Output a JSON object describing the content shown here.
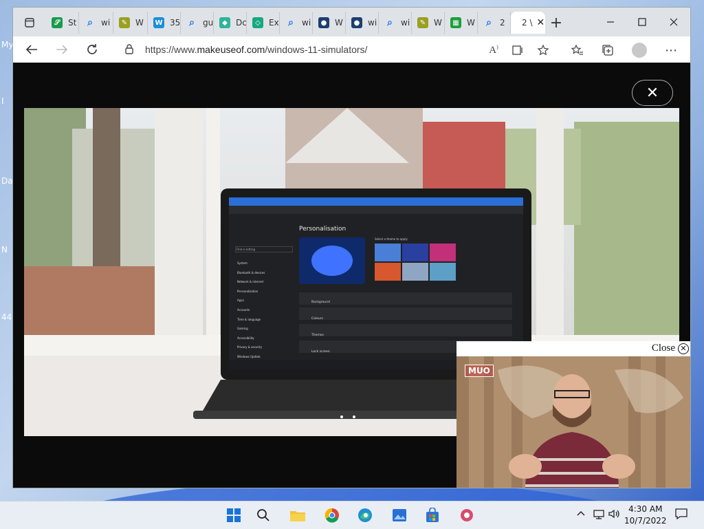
{
  "desktop": {
    "labels": [
      "My",
      "I",
      "Da",
      "N",
      "44"
    ]
  },
  "browser": {
    "tabs": [
      {
        "title": "St",
        "icon": "brand-icon",
        "color": "#1a9a4a",
        "glyph": "𝒮"
      },
      {
        "title": "wi",
        "icon": "search-icon",
        "color": "#1a73e8",
        "glyph": "⌕"
      },
      {
        "title": "W",
        "icon": "pencil-icon",
        "color": "#9aa020",
        "glyph": "✎"
      },
      {
        "title": "35",
        "icon": "w-icon",
        "color": "#1b8fd8",
        "glyph": "W"
      },
      {
        "title": "gu",
        "icon": "search-icon",
        "color": "#1a73e8",
        "glyph": "⌕"
      },
      {
        "title": "Dc",
        "icon": "diamond-icon",
        "color": "#2fb39a",
        "glyph": "◆"
      },
      {
        "title": "Ex",
        "icon": "gem-icon",
        "color": "#18a880",
        "glyph": "◇"
      },
      {
        "title": "wi",
        "icon": "search-icon",
        "color": "#1a73e8",
        "glyph": "⌕"
      },
      {
        "title": "W",
        "icon": "circle-icon",
        "color": "#1d3f6e",
        "glyph": "●"
      },
      {
        "title": "wi",
        "icon": "circle-icon",
        "color": "#1d3f6e",
        "glyph": "●"
      },
      {
        "title": "wi",
        "icon": "search-icon",
        "color": "#1a73e8",
        "glyph": "⌕"
      },
      {
        "title": "W",
        "icon": "pencil-icon",
        "color": "#9aa020",
        "glyph": "✎"
      },
      {
        "title": "W",
        "icon": "grid-icon",
        "color": "#1e9e3e",
        "glyph": "▦"
      },
      {
        "title": "2",
        "icon": "search-icon",
        "color": "#1a73e8",
        "glyph": "⌕"
      },
      {
        "title": "2 \\",
        "icon": "",
        "color": "#ffffff",
        "glyph": ""
      }
    ],
    "url_prefix": "https://www.",
    "url_host": "makeuseof.com",
    "url_path": "/windows-11-simulators/",
    "new_tab": "+",
    "close_tab": "✕"
  },
  "lightbox": {
    "close_glyph": "✕",
    "photo_description_hidden": true
  },
  "video": {
    "close_label": "Close",
    "close_glyph": "✕",
    "logo": "MUO"
  },
  "taskbar": {
    "time": "4:30 AM",
    "date": "10/7/2022"
  },
  "laptop_screen": {
    "section_title": "Personalisation",
    "search_placeholder": "Find a setting",
    "theme_prompt": "Select a theme to apply",
    "menu": [
      "System",
      "Bluetooth & devices",
      "Network & internet",
      "Personalisation",
      "Apps",
      "Accounts",
      "Time & language",
      "Gaming",
      "Accessibility",
      "Privacy & security",
      "Windows Update"
    ],
    "rows": [
      "Background",
      "Colours",
      "Themes",
      "Lock screen"
    ]
  }
}
